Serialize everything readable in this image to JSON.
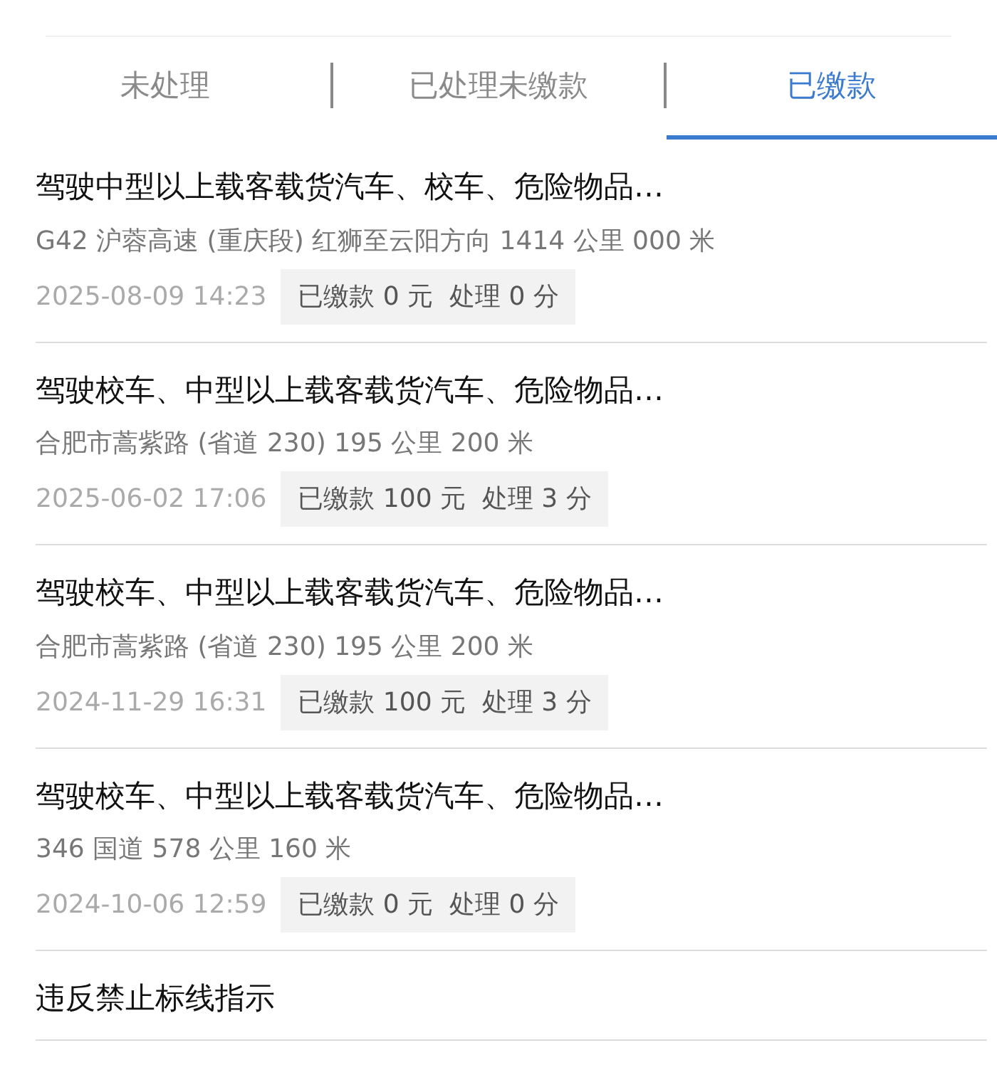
{
  "tabs": [
    {
      "label": "未处理",
      "selected": false
    },
    {
      "label": "已处理未缴款",
      "selected": false
    },
    {
      "label": "已缴款",
      "selected": true
    }
  ],
  "records": [
    {
      "title": "驾驶中型以上载客载货汽车、校车、危险物品…",
      "location": "G42 沪蓉高速 (重庆段) 红狮至云阳方向 1414 公里 000 米",
      "time": "2025-08-09 14:23",
      "result": "已缴款 0 元  处理 0 分"
    },
    {
      "title": "驾驶校车、中型以上载客载货汽车、危险物品…",
      "location": "合肥市蒿紫路 (省道 230) 195 公里 200 米",
      "time": "2025-06-02 17:06",
      "result": "已缴款 100 元  处理 3 分"
    },
    {
      "title": "驾驶校车、中型以上载客载货汽车、危险物品…",
      "location": "合肥市蒿紫路 (省道 230) 195 公里 200 米",
      "time": "2024-11-29 16:31",
      "result": "已缴款 100 元  处理 3 分"
    },
    {
      "title": "驾驶校车、中型以上载客载货汽车、危险物品…",
      "location": "346 国道 578 公里 160 米",
      "time": "2024-10-06 12:59",
      "result": "已缴款 0 元  处理 0 分"
    },
    {
      "title": "违反禁止标线指示"
    }
  ]
}
